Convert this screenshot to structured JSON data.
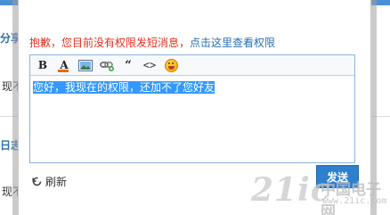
{
  "background": {
    "left_labels": [
      "分享",
      "日志"
    ],
    "left_texts": [
      "现不",
      "现不"
    ]
  },
  "dialog": {
    "notice_text": "抱歉，您目前没有权限发短消息，",
    "notice_link": "点击这里查看权限",
    "toolbar": {
      "bold_label": "B",
      "color_label": "A",
      "quote_label": "“",
      "code_label": "<>"
    },
    "editor_text": "您好，我现在的权限，还加不了您好友",
    "refresh_label": "刷新",
    "send_label": "发送"
  },
  "watermark": {
    "big": "21ic",
    "cn": "中国电子网",
    "small": "www.21ic.com"
  },
  "colors": {
    "notice_red": "#e0301e",
    "link_blue": "#2a6fb0",
    "selection": "#3399ff",
    "send_button": "#2f7fcf"
  }
}
